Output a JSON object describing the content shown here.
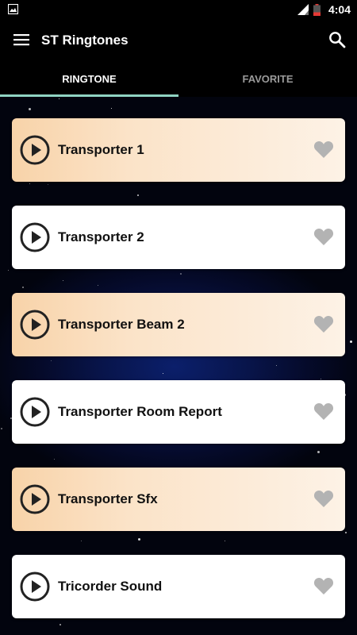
{
  "status_bar": {
    "time": "4:04",
    "icons": [
      "image-icon",
      "signal-icon",
      "battery-icon"
    ]
  },
  "app_bar": {
    "title": "ST Ringtones",
    "icons": [
      "menu-icon",
      "search-icon"
    ]
  },
  "tabs": [
    {
      "label": "RINGTONE",
      "active": true
    },
    {
      "label": "FAVORITE",
      "active": false
    }
  ],
  "ringtones": [
    {
      "title": "Transporter 1",
      "style": "peach"
    },
    {
      "title": "Transporter 2",
      "style": "white"
    },
    {
      "title": "Transporter Beam 2",
      "style": "peach"
    },
    {
      "title": "Transporter Room Report",
      "style": "white"
    },
    {
      "title": "Transporter Sfx",
      "style": "peach"
    },
    {
      "title": "Tricorder Sound",
      "style": "white"
    }
  ],
  "colors": {
    "tab_indicator": "#8fd3c2",
    "peach_card": "#f8d3a9",
    "heart": "#b3b3b3"
  }
}
